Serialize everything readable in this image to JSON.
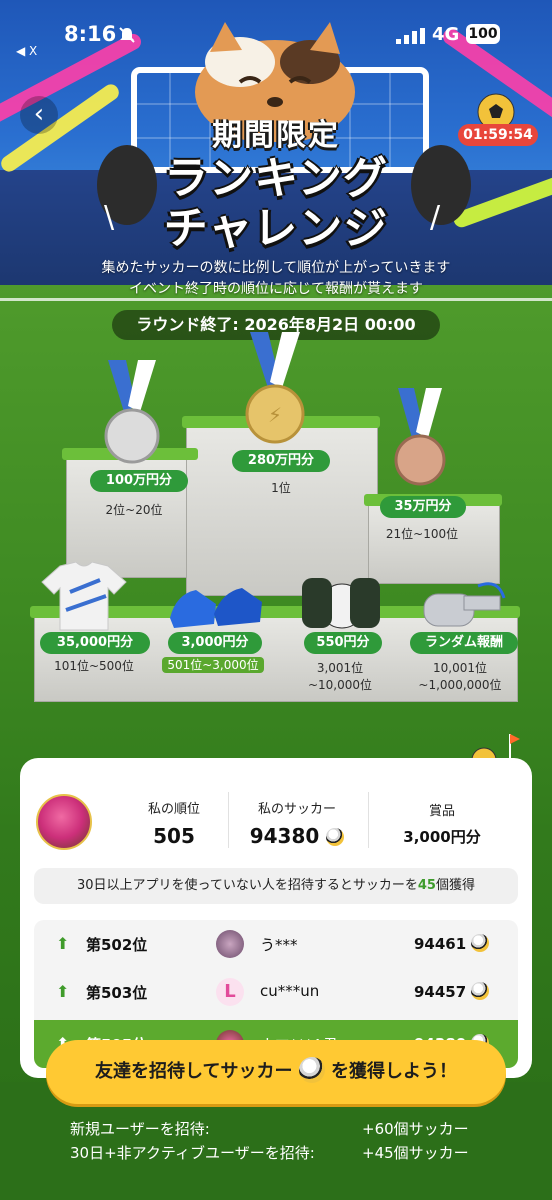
{
  "status_bar": {
    "time": "8:16",
    "back_hint": "◀ X",
    "network": "4G",
    "battery": "100"
  },
  "header": {
    "countdown": "01:59:54",
    "title_line1": "期間限定",
    "title_line2": "ランキング",
    "title_line3": "チャレンジ"
  },
  "description": {
    "line1": "集めたサッカーの数に比例して順位が上がっていきます",
    "line2": "イベント終了時の順位に応じて報酬が貰えます"
  },
  "round_end": "ラウンド終了: 2026年8月2日 00:00",
  "prizes": [
    {
      "prize": "280万円分",
      "rank": "1位"
    },
    {
      "prize": "100万円分",
      "rank": "2位~20位"
    },
    {
      "prize": "35万円分",
      "rank": "21位~100位"
    },
    {
      "prize": "35,000円分",
      "rank": "101位~500位"
    },
    {
      "prize": "3,000円分",
      "rank": "501位~3,000位"
    },
    {
      "prize": "550円分",
      "rank_a": "3,001位",
      "rank_b": "~10,000位"
    },
    {
      "prize": "ランダム報酬",
      "rank_a": "10,001位",
      "rank_b": "~1,000,000位"
    }
  ],
  "my_stats": {
    "rank_label": "私の順位",
    "rank_value": "505",
    "soccer_label": "私のサッカー",
    "soccer_value": "94380",
    "prize_label": "賞品",
    "prize_value": "3,000円分"
  },
  "invite_note": {
    "before": "30日以上アプリを使っていない人を招待するとサッカーを",
    "count": "45",
    "after": "個獲得"
  },
  "leaderboard": [
    {
      "rank": "第502位",
      "name": "う***",
      "score": "94461"
    },
    {
      "rank": "第503位",
      "name": "cu***un",
      "score": "94457"
    },
    {
      "rank": "第505位",
      "name": "ウマ***A君",
      "score": "94380"
    }
  ],
  "cta": {
    "before": "友達を招待してサッカー",
    "after": "を獲得しよう！"
  },
  "rewards": [
    {
      "label": "新規ユーザーを招待:",
      "value": "+60個サッカー"
    },
    {
      "label": "30日+非アクティブユーザーを招待:",
      "value": "+45個サッカー"
    }
  ],
  "colors": {
    "accent_green": "#5caa2e",
    "timer_red": "#e8463b",
    "cta_yellow": "#ffc933"
  }
}
